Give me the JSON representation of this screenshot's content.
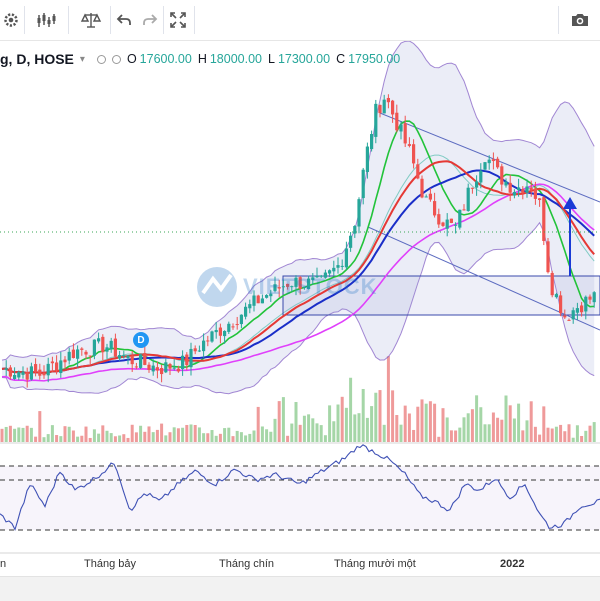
{
  "toolbar": {
    "icons": [
      "gear-icon",
      "indicators-icon",
      "compare-scale-icon",
      "undo-icon",
      "redo-icon",
      "fullscreen-icon",
      "camera-icon"
    ]
  },
  "legend": {
    "symbol": "g, D, HOSE",
    "caret": "▾",
    "o_label": "O",
    "o_value": "17600.00",
    "h_label": "H",
    "h_value": "18000.00",
    "l_label": "L",
    "l_value": "17300.00",
    "c_label": "C",
    "c_value": "17950.00"
  },
  "xaxis": {
    "ticks": [
      {
        "label": "n",
        "x": 0,
        "bold": false
      },
      {
        "label": "Tháng bảy",
        "x": 84,
        "bold": false
      },
      {
        "label": "Tháng chín",
        "x": 219,
        "bold": false
      },
      {
        "label": "Tháng mười một",
        "x": 334,
        "bold": false
      },
      {
        "label": "2022",
        "x": 500,
        "bold": true
      }
    ]
  },
  "marker": {
    "label": "D"
  },
  "watermark": {
    "text": "VIETSTOCK"
  },
  "colors": {
    "up": "#26a69a",
    "down": "#ef5350",
    "vol_up": "#a5d6a7",
    "vol_down": "#ef9a9a",
    "sma_green": "#22c33a",
    "sma_red": "#e53935",
    "sma_blue": "#1a2ec8",
    "sma_magenta": "#e040fb",
    "bollinger": "#7e57c2",
    "rsi": "#3f51b5"
  },
  "chart_data": {
    "type": "candlestick",
    "symbol": "g, D, HOSE",
    "ohlc_last": {
      "open": 17600,
      "high": 18000,
      "low": 17300,
      "close": 17950
    },
    "x_ticks": [
      "n",
      "Tháng bảy",
      "Tháng chín",
      "Tháng mười một",
      "2022"
    ],
    "overlays": [
      "Bollinger Bands",
      "SMA green",
      "SMA red",
      "SMA blue",
      "SMA magenta",
      "trend channel",
      "rectangle"
    ],
    "price_track": [
      {
        "x": 0,
        "p": 0.04
      },
      {
        "x": 40,
        "p": 0.02
      },
      {
        "x": 75,
        "p": 0.1
      },
      {
        "x": 105,
        "p": 0.12
      },
      {
        "x": 130,
        "p": 0.07
      },
      {
        "x": 160,
        "p": 0.04
      },
      {
        "x": 185,
        "p": 0.06
      },
      {
        "x": 200,
        "p": 0.12
      },
      {
        "x": 230,
        "p": 0.2
      },
      {
        "x": 260,
        "p": 0.28
      },
      {
        "x": 290,
        "p": 0.34
      },
      {
        "x": 320,
        "p": 0.33
      },
      {
        "x": 340,
        "p": 0.4
      },
      {
        "x": 355,
        "p": 0.55
      },
      {
        "x": 365,
        "p": 0.75
      },
      {
        "x": 375,
        "p": 0.92
      },
      {
        "x": 385,
        "p": 0.98
      },
      {
        "x": 395,
        "p": 0.9
      },
      {
        "x": 410,
        "p": 0.78
      },
      {
        "x": 425,
        "p": 0.62
      },
      {
        "x": 440,
        "p": 0.56
      },
      {
        "x": 455,
        "p": 0.52
      },
      {
        "x": 470,
        "p": 0.66
      },
      {
        "x": 485,
        "p": 0.78
      },
      {
        "x": 500,
        "p": 0.7
      },
      {
        "x": 515,
        "p": 0.66
      },
      {
        "x": 530,
        "p": 0.68
      },
      {
        "x": 540,
        "p": 0.6
      },
      {
        "x": 550,
        "p": 0.34
      },
      {
        "x": 565,
        "p": 0.22
      },
      {
        "x": 580,
        "p": 0.26
      },
      {
        "x": 600,
        "p": 0.3
      }
    ],
    "rsi_track": [
      {
        "x": 0,
        "v": 0.2
      },
      {
        "x": 15,
        "v": 0.05
      },
      {
        "x": 30,
        "v": 0.55
      },
      {
        "x": 45,
        "v": 0.3
      },
      {
        "x": 60,
        "v": 0.7
      },
      {
        "x": 75,
        "v": 0.48
      },
      {
        "x": 95,
        "v": 0.62
      },
      {
        "x": 115,
        "v": 0.8
      },
      {
        "x": 130,
        "v": 0.25
      },
      {
        "x": 145,
        "v": 0.45
      },
      {
        "x": 160,
        "v": 0.35
      },
      {
        "x": 175,
        "v": 0.52
      },
      {
        "x": 195,
        "v": 0.7
      },
      {
        "x": 215,
        "v": 0.55
      },
      {
        "x": 235,
        "v": 0.72
      },
      {
        "x": 255,
        "v": 0.6
      },
      {
        "x": 275,
        "v": 0.66
      },
      {
        "x": 300,
        "v": 0.55
      },
      {
        "x": 325,
        "v": 0.72
      },
      {
        "x": 345,
        "v": 0.85
      },
      {
        "x": 360,
        "v": 1.0
      },
      {
        "x": 375,
        "v": 0.92
      },
      {
        "x": 390,
        "v": 0.82
      },
      {
        "x": 405,
        "v": 0.66
      },
      {
        "x": 420,
        "v": 0.42
      },
      {
        "x": 435,
        "v": 0.35
      },
      {
        "x": 450,
        "v": 0.25
      },
      {
        "x": 465,
        "v": 0.55
      },
      {
        "x": 480,
        "v": 0.48
      },
      {
        "x": 495,
        "v": 0.62
      },
      {
        "x": 510,
        "v": 0.4
      },
      {
        "x": 525,
        "v": 0.55
      },
      {
        "x": 540,
        "v": 0.2
      },
      {
        "x": 550,
        "v": 0.05
      },
      {
        "x": 565,
        "v": 0.1
      },
      {
        "x": 580,
        "v": 0.3
      },
      {
        "x": 600,
        "v": 0.35
      }
    ]
  }
}
